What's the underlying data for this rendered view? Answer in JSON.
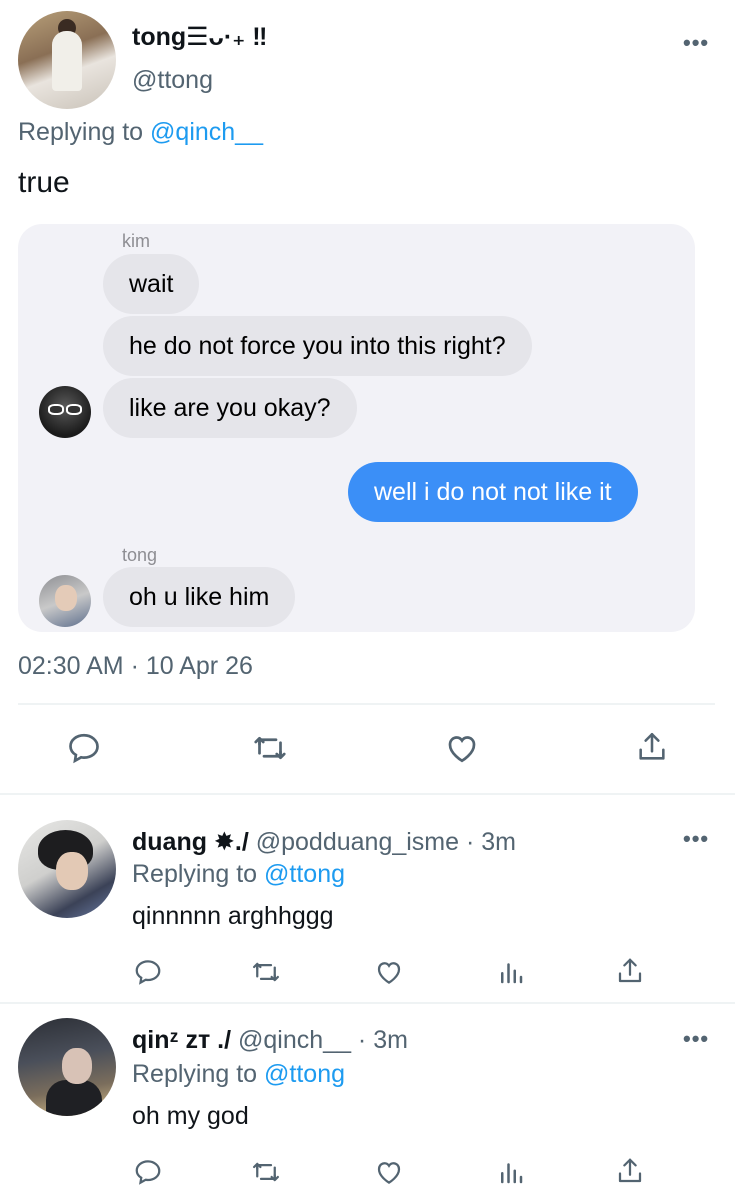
{
  "main_tweet": {
    "display_name": "tong☰ᴗ·₊ ‼",
    "handle": "@ttong",
    "replying_prefix": "Replying to",
    "replying_to": "@qinch__",
    "text": "true",
    "timestamp": "02:30 AM · 10 Apr 26",
    "more_label": "•••"
  },
  "chat": {
    "sender1_name": "kim",
    "messages_kim": [
      "wait",
      "he do not force you into this right?",
      "like are you okay?"
    ],
    "message_me": "well i do not not like it",
    "sender2_name": "tong",
    "message_tong": "oh u like him"
  },
  "replies": [
    {
      "display_name": "duang ✸./",
      "handle": "@podduang_isme",
      "time": "· 3m",
      "replying_prefix": "Replying to",
      "replying_to": "@ttong",
      "text": "qinnnnn arghhggg"
    },
    {
      "display_name": "qinᶻ zᴛ ./",
      "handle": "@qinch__",
      "time": "· 3m",
      "replying_prefix": "Replying to",
      "replying_to": "@ttong",
      "text": "oh my god"
    }
  ],
  "icons": [
    "reply-icon",
    "retweet-icon",
    "like-icon",
    "views-icon",
    "share-icon",
    "more-icon"
  ],
  "colors": {
    "accent": "#1d9bf0",
    "imessage_blue": "#3b8ff7",
    "bubble_gray": "#e5e5ea",
    "muted": "#536471"
  }
}
